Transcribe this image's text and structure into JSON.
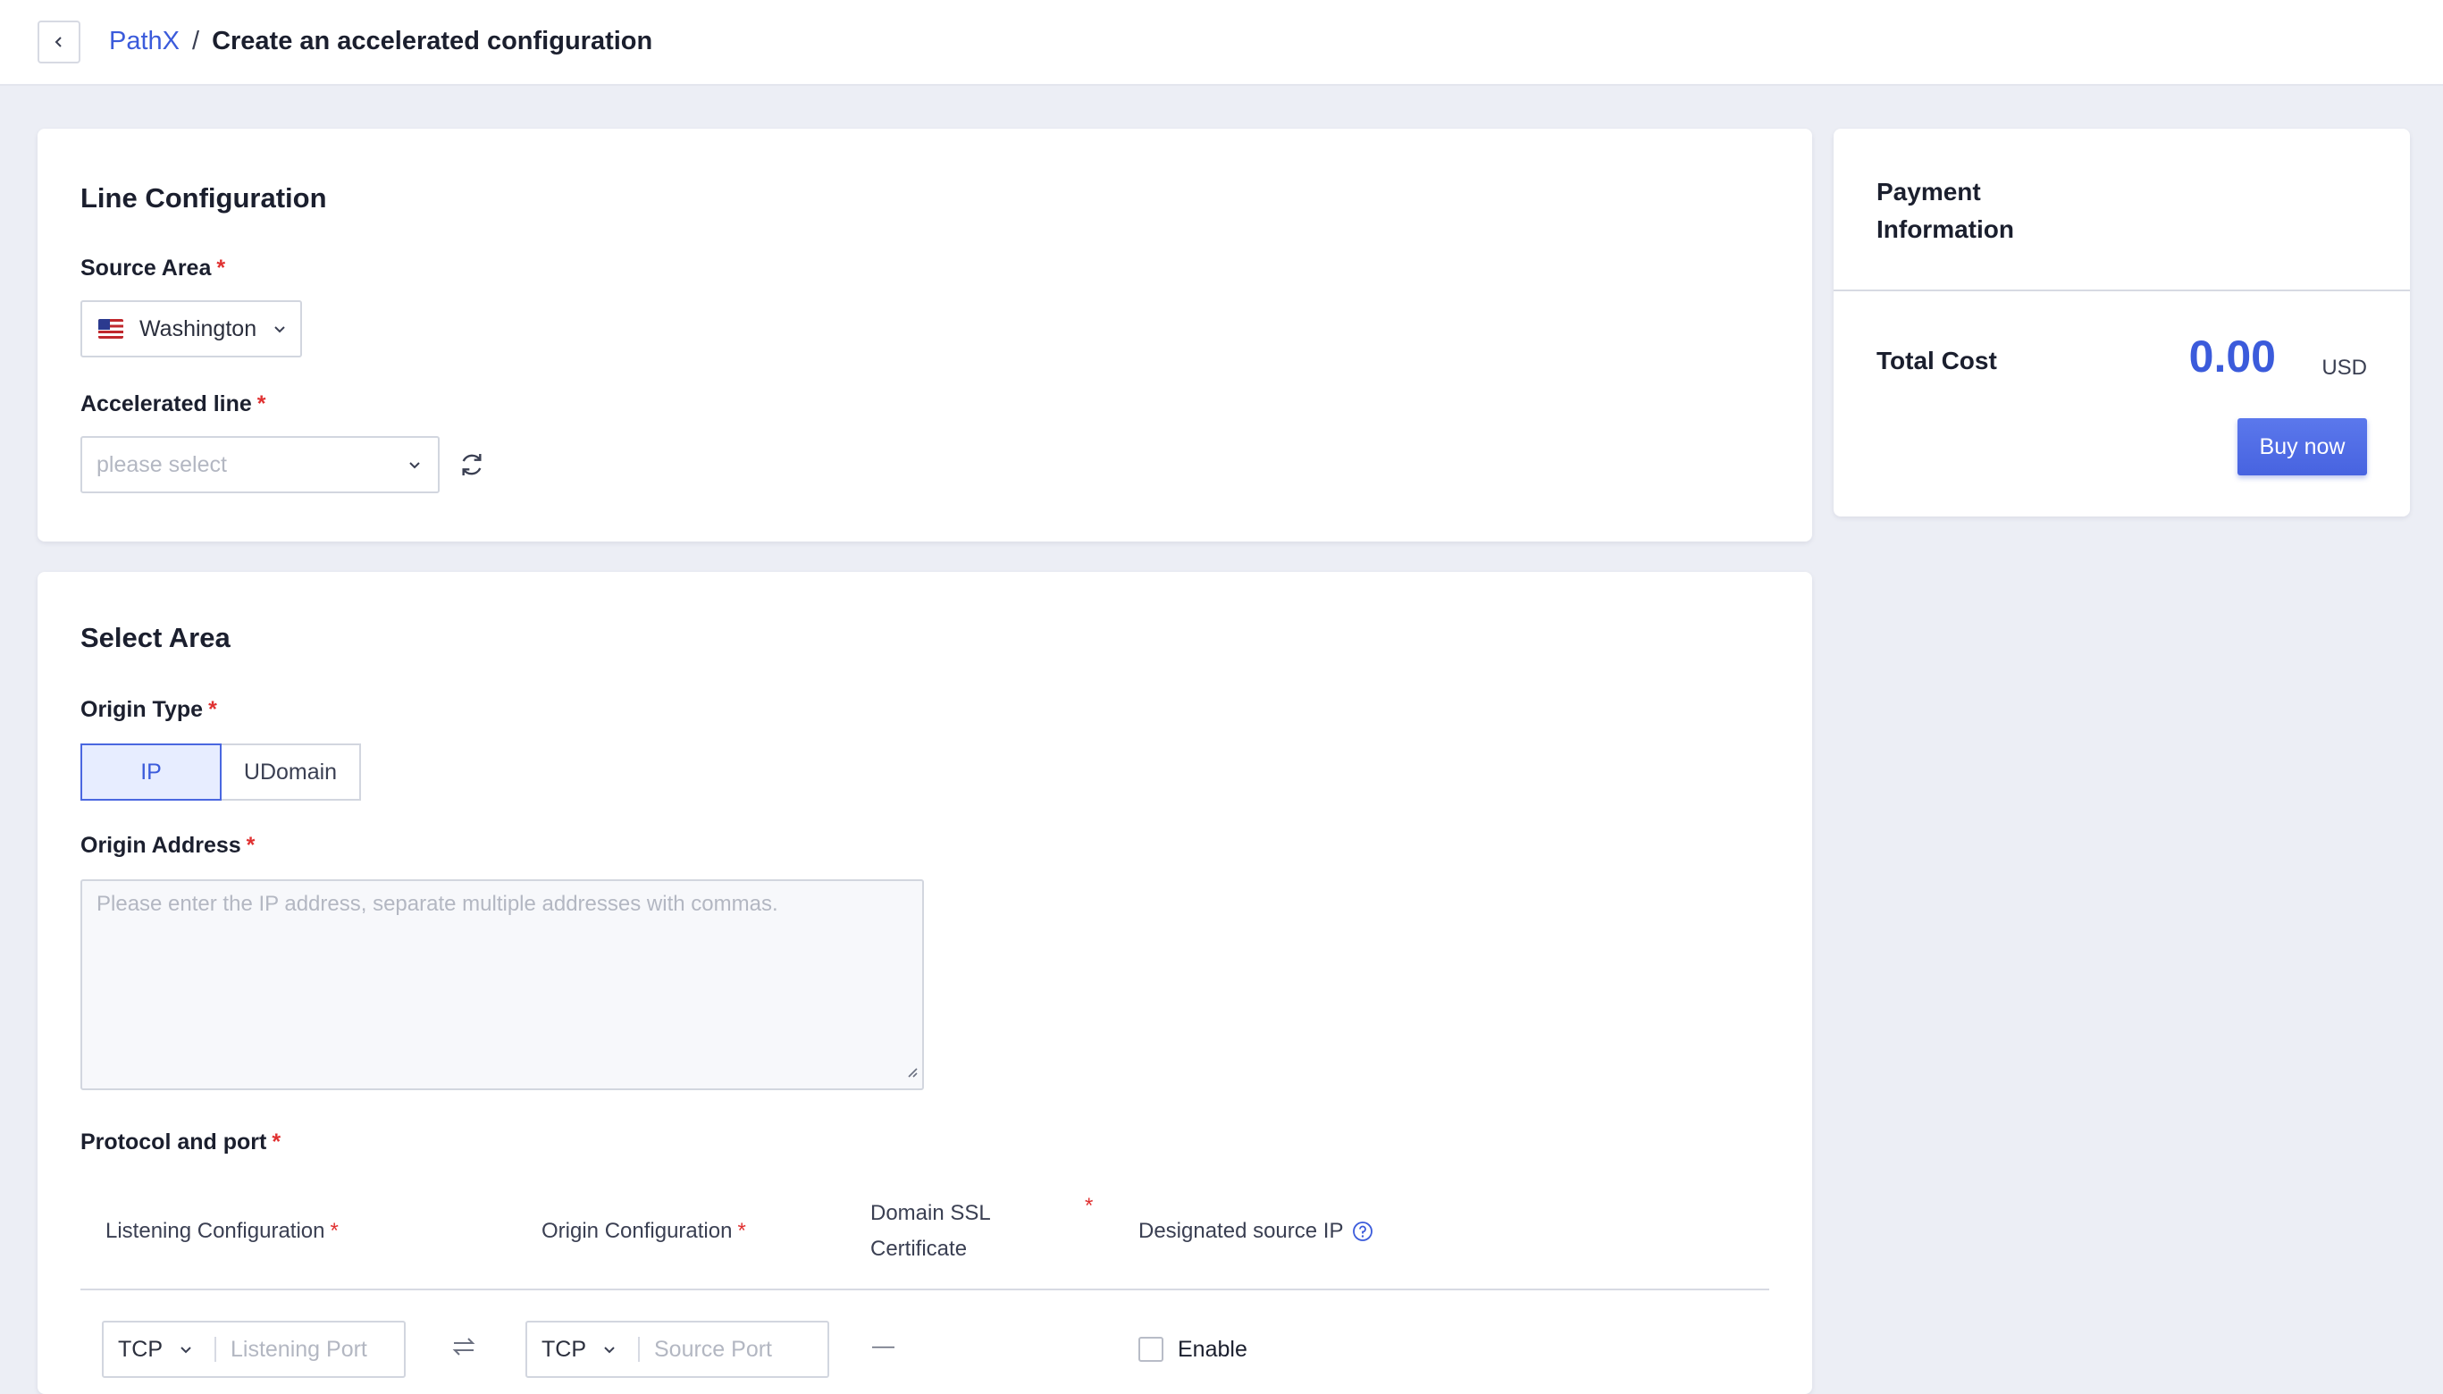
{
  "header": {
    "back_icon": "chevron-left-icon",
    "breadcrumb_root": "PathX",
    "breadcrumb_sep": "/",
    "breadcrumb_current": "Create an accelerated configuration"
  },
  "line_config": {
    "title": "Line Configuration",
    "source_area_label": "Source Area",
    "source_area_value": "Washington",
    "accelerated_line_label": "Accelerated line",
    "accelerated_line_placeholder": "please select",
    "required_mark": "*"
  },
  "select_area": {
    "title": "Select Area",
    "origin_type_label": "Origin Type",
    "origin_type_options": [
      "IP",
      "UDomain"
    ],
    "origin_type_selected": "IP",
    "origin_address_label": "Origin Address",
    "origin_address_placeholder": "Please enter the IP address, separate multiple addresses with commas.",
    "protocol_label": "Protocol and port",
    "columns": {
      "listening": "Listening Configuration",
      "origin": "Origin Configuration",
      "ssl_line1": "Domain SSL",
      "ssl_line2": "Certificate",
      "designated": "Designated source IP"
    },
    "row": {
      "listen_protocol": "TCP",
      "listen_port_placeholder": "Listening Port",
      "origin_protocol": "TCP",
      "origin_port_placeholder": "Source Port",
      "ssl_value": "—",
      "enable_label": "Enable"
    }
  },
  "payment": {
    "title": "Payment Information",
    "total_label": "Total Cost",
    "amount": "0.00",
    "currency": "USD",
    "buy_label": "Buy now"
  },
  "colors": {
    "accent": "#3b5bdb",
    "required": "#e03131",
    "background": "#eceef5"
  }
}
